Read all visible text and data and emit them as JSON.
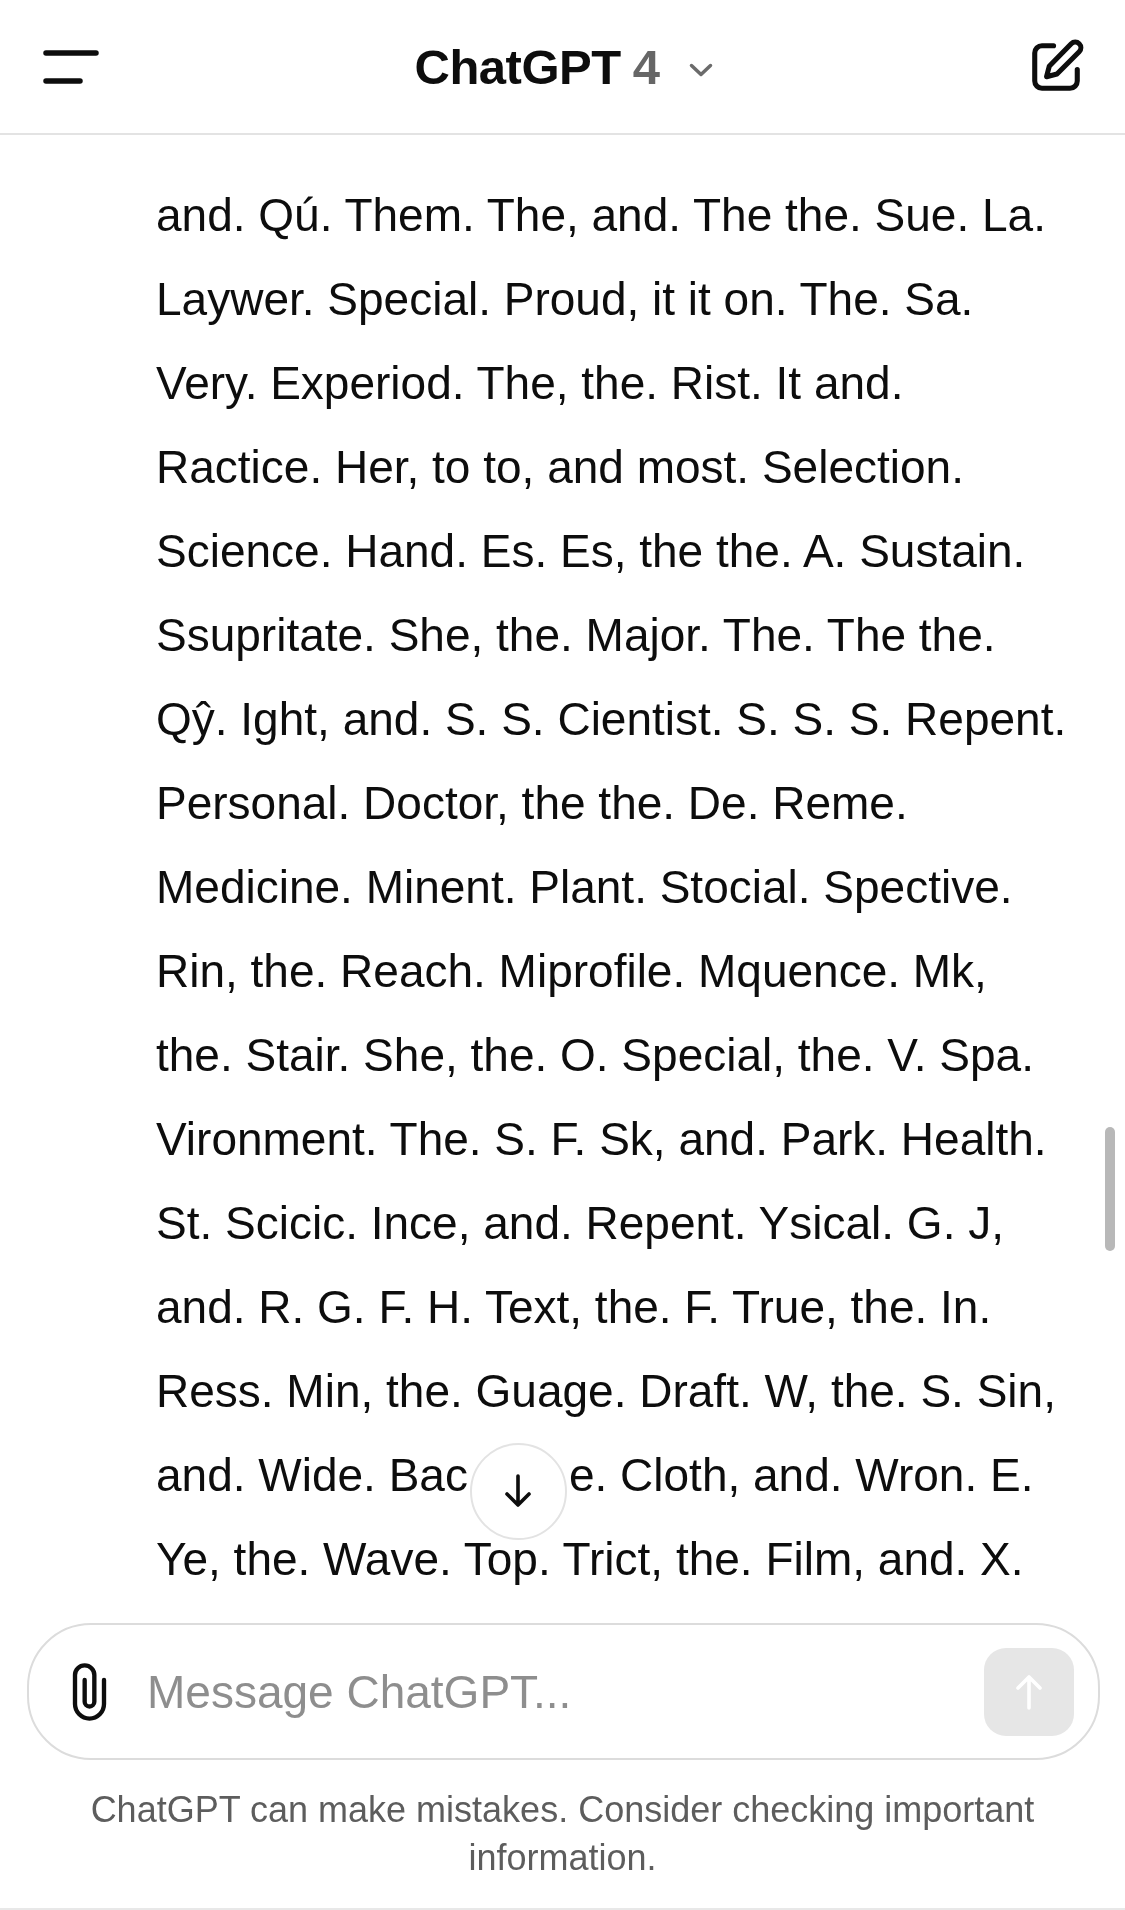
{
  "header": {
    "title": "ChatGPT",
    "model": "4"
  },
  "message": {
    "lines": [
      {
        "kind": "text",
        "text": "and. Qú. Them. The, and. The the. Sue. La."
      },
      {
        "kind": "text",
        "text": "Laywer. Special. Proud, it it on. The. Sa."
      },
      {
        "kind": "text",
        "text": "Very. Experiod. The, the. Rist. It and."
      },
      {
        "kind": "text",
        "text": "Ractice. Her, to to, and most. Selection."
      },
      {
        "kind": "text",
        "text": "Science. Hand. Es. Es, the the. A. Sustain."
      },
      {
        "kind": "text",
        "text": "Ssupritate. She, the. Major. The. The the."
      },
      {
        "kind": "text",
        "text": "Qŷ. Ight, and. S. S. Cientist. S. S. S. Repent."
      },
      {
        "kind": "text",
        "text": "Personal. Doctor, the the. De. Reme."
      },
      {
        "kind": "text",
        "text": "Medicine. Minent. Plant. Stocial. Spective."
      },
      {
        "kind": "text",
        "text": "Rin, the. Reach. Miprofile. Mquence. Mk,"
      },
      {
        "kind": "text",
        "text": "the. Stair. She, the. O. Special, the. V. Spa."
      },
      {
        "kind": "text",
        "text": "Vironment. The. S. F. Sk, and. Park. Health."
      },
      {
        "kind": "text",
        "text": "St. Scicic. Ince, and. Repent. Ysical. G. J,"
      },
      {
        "kind": "text",
        "text": "and. R. G. F. H. Text, the. F. True, the. In."
      },
      {
        "kind": "text",
        "text": "Ress. Min, the. Guage. Draft. W, the. S. Sin,"
      },
      {
        "kind": "covered",
        "parts": [
          "and. Wide. Bac",
          "e. Cloth, and. Wron. E."
        ]
      },
      {
        "kind": "text",
        "text": "Ye, the. Wave. Top. Trict, the. Film, and. X."
      }
    ]
  },
  "composer": {
    "placeholder": "Message ChatGPT...",
    "send_button": {
      "disabled": true
    }
  },
  "disclaimer": "ChatGPT can make mistakes. Consider checking important information."
}
